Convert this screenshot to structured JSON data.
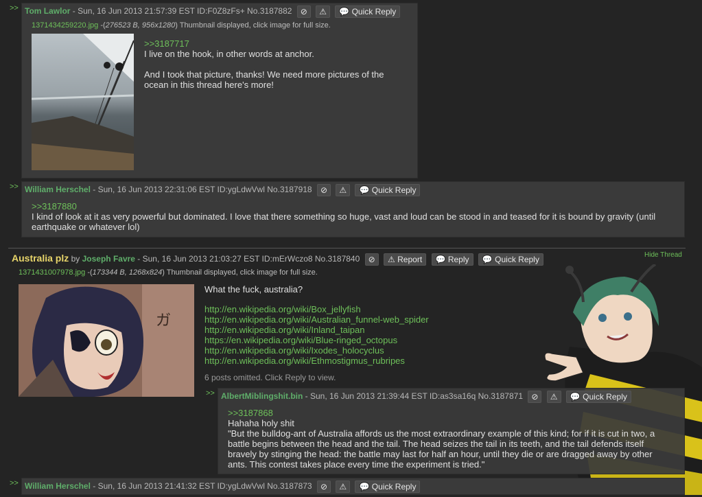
{
  "post1": {
    "arrows": ">>",
    "name": "Tom Lawlor",
    "meta": " - Sun, 16 Jun 2013 21:57:39 EST ID:F0Z8zFs+ No.3187882",
    "quick_reply": "Quick Reply",
    "file_name": "1371434259220.jpg",
    "file_info_italic": "276523 B, 956x1280",
    "file_info_suffix": ") Thumbnail displayed, click image for full size.",
    "quote": ">>3187717",
    "line1": "I live on the hook, in other words at anchor.",
    "line2": "And I took that picture, thanks! We need more pictures of the ocean in this thread here's more!"
  },
  "post2": {
    "arrows": ">>",
    "name": "William Herschel",
    "meta": " - Sun, 16 Jun 2013 22:31:06 EST ID:ygLdwVwl No.3187918",
    "quick_reply": "Quick Reply",
    "quote": ">>3187880",
    "text": "I kind of look at it as very powerful but dominated. I love that there something so huge, vast and loud can be stood in and teased for it is bound by gravity (until earthquake or whatever lol)"
  },
  "op": {
    "subject": "Australia plz",
    "by": " by ",
    "name": "Joseph Favre",
    "meta": " - Sun, 16 Jun 2013 21:03:27 EST ID:mErWczo8 No.3187840",
    "report": "Report",
    "reply": "Reply",
    "quick_reply": "Quick Reply",
    "hide_thread": "Hide Thread",
    "file_name": "1371431007978.jpg",
    "file_info_italic": "173344 B, 1268x824",
    "file_info_suffix": ") Thumbnail displayed, click image for full size.",
    "text": "What the fuck, australia?",
    "links": [
      "http://en.wikipedia.org/wiki/Box_jellyfish",
      "http://en.wikipedia.org/wiki/Australian_funnel-web_spider",
      "http://en.wikipedia.org/wiki/Inland_taipan",
      "https://en.wikipedia.org/wiki/Blue-ringed_octopus",
      "http://en.wikipedia.org/wiki/Ixodes_holocyclus",
      "http://en.wikipedia.org/wiki/Ethmostigmus_rubripes"
    ],
    "omitted": "6 posts omitted. Click Reply to view."
  },
  "post3": {
    "arrows": ">>",
    "name": "AlbertMiblingshit.bin",
    "meta": " - Sun, 16 Jun 2013 21:39:44 EST ID:as3sa16q No.3187871",
    "quick_reply": "Quick Reply",
    "quote": ">>3187868",
    "line1": "Hahaha holy shit",
    "line2": "\"But the bulldog-ant of Australia affords us the most extraordinary example of this kind; for if it is cut in two, a battle begins between the head and the tail. The head seizes the tail in its teeth, and the tail defends itself bravely by stinging the head: the battle may last for half an hour, until they die or are dragged away by other ants. This contest takes place every time the experiment is tried.\""
  },
  "post4": {
    "arrows": ">>",
    "name": "William Herschel",
    "meta": " - Sun, 16 Jun 2013 21:41:32 EST ID:ygLdwVwl No.3187873",
    "quick_reply": "Quick Reply"
  },
  "icons": {
    "hide": "hide-icon",
    "report": "warning-icon",
    "reply": "speech-bubble-icon"
  },
  "colors": {
    "background": "#242424",
    "post_bg": "#3a3a3a",
    "link": "#6ec05a",
    "name": "#5fae6a",
    "subject": "#e8d56a"
  }
}
